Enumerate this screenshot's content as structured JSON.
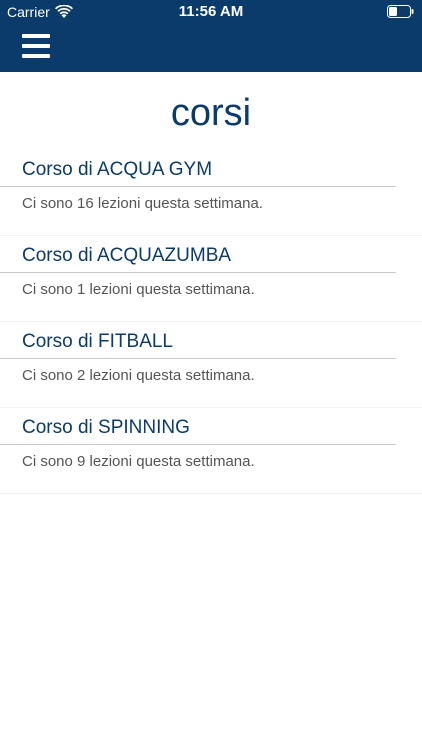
{
  "status_bar": {
    "carrier": "Carrier",
    "time": "11:56 AM"
  },
  "header": {
    "menu_icon": "hamburger-menu-icon",
    "background_color": "#0b3b6b"
  },
  "page": {
    "title": "corsi"
  },
  "courses": [
    {
      "name": "Corso di ACQUA GYM",
      "info": "Ci sono 16 lezioni questa settimana."
    },
    {
      "name": "Corso di ACQUAZUMBA",
      "info": "Ci sono 1 lezioni questa settimana."
    },
    {
      "name": "Corso di FITBALL",
      "info": "Ci sono 2 lezioni questa settimana."
    },
    {
      "name": "Corso di SPINNING",
      "info": "Ci sono 9 lezioni questa settimana."
    }
  ],
  "colors": {
    "accent": "#0b3b6b",
    "info_text": "#555555"
  }
}
